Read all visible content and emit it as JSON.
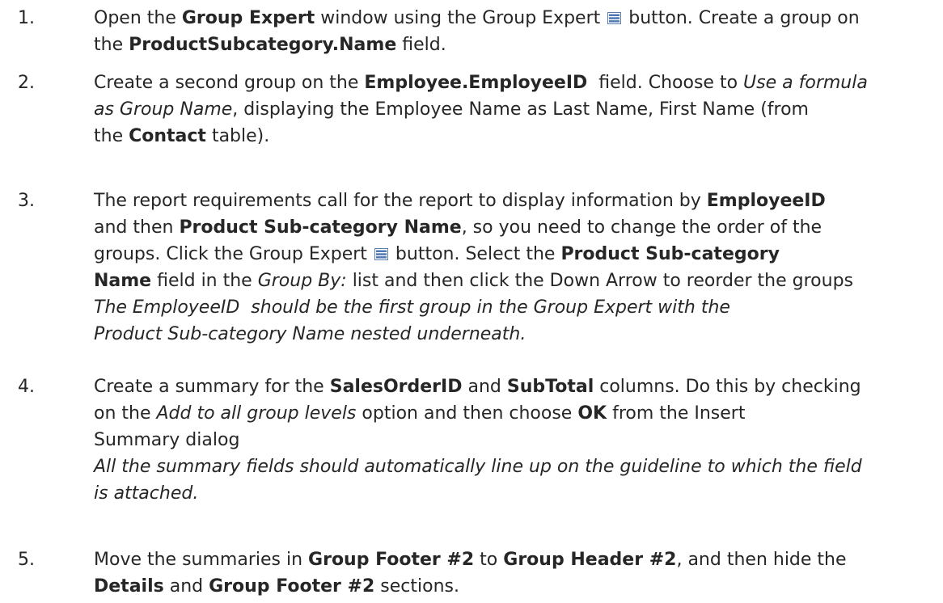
{
  "steps": [
    {
      "number": "1.",
      "lines": [
        [
          {
            "t": "Open the "
          },
          {
            "t": "Group Expert",
            "b": true
          },
          {
            "t": " window using the Group Expert "
          },
          {
            "icon": "group-expert-icon"
          },
          {
            "t": " button. Create a group on"
          }
        ],
        [
          {
            "t": "the "
          },
          {
            "t": "ProductSubcategory.Name",
            "b": true
          },
          {
            "t": " field."
          }
        ]
      ]
    },
    {
      "number": "2.",
      "lines": [
        [
          {
            "t": "Create a second group on the "
          },
          {
            "t": "Employee.EmployeeID",
            "b": true
          },
          {
            "t": "  field. Choose to "
          },
          {
            "t": "Use a formula",
            "i": true
          }
        ],
        [
          {
            "t": "as Group Name",
            "i": true
          },
          {
            "t": ", displaying the Employee Name as Last Name, First Name (from"
          }
        ],
        [
          {
            "t": "the "
          },
          {
            "t": "Contact",
            "b": true
          },
          {
            "t": " table)."
          }
        ]
      ]
    },
    {
      "number": "3.",
      "lines": [
        [
          {
            "t": "The report requirements call for the report to display information by "
          },
          {
            "t": "EmployeeID",
            "b": true
          }
        ],
        [
          {
            "t": "and then "
          },
          {
            "t": "Product Sub-category Name",
            "b": true
          },
          {
            "t": ", so you need to change the order of the"
          }
        ],
        [
          {
            "t": "groups. Click the Group Expert "
          },
          {
            "icon": "group-expert-icon"
          },
          {
            "t": " button. Select the "
          },
          {
            "t": "Product Sub-category",
            "b": true
          }
        ],
        [
          {
            "t": "Name",
            "b": true
          },
          {
            "t": " field in the "
          },
          {
            "t": "Group By:",
            "i": true
          },
          {
            "t": " list and then click the Down Arrow to reorder the groups"
          }
        ],
        [
          {
            "t": "The EmployeeID  should be the first group in the Group Expert with the",
            "i": true
          }
        ],
        [
          {
            "t": "Product Sub-category Name nested underneath.",
            "i": true
          }
        ]
      ]
    },
    {
      "number": "4.",
      "lines": [
        [
          {
            "t": "Create a summary for the "
          },
          {
            "t": "SalesOrderID",
            "b": true
          },
          {
            "t": " and "
          },
          {
            "t": "SubTotal",
            "b": true
          },
          {
            "t": " columns. Do this by checking"
          }
        ],
        [
          {
            "t": "on the "
          },
          {
            "t": "Add to all group levels",
            "i": true
          },
          {
            "t": " option and then choose "
          },
          {
            "t": "OK",
            "b": true
          },
          {
            "t": " from the Insert"
          }
        ],
        [
          {
            "t": "Summary dialog"
          }
        ],
        [
          {
            "t": "All the summary fields should automatically line up on the guideline to which the field",
            "i": true
          }
        ],
        [
          {
            "t": "is attached.",
            "i": true
          }
        ]
      ]
    },
    {
      "number": "5.",
      "lines": [
        [
          {
            "t": "Move the summaries in "
          },
          {
            "t": "Group Footer #2",
            "b": true
          },
          {
            "t": " to "
          },
          {
            "t": "Group Header #2",
            "b": true
          },
          {
            "t": ", and then hide the"
          }
        ],
        [
          {
            "t": "Details",
            "b": true
          },
          {
            "t": " and "
          },
          {
            "t": "Group Footer #2",
            "b": true
          },
          {
            "t": " sections."
          }
        ]
      ]
    }
  ]
}
